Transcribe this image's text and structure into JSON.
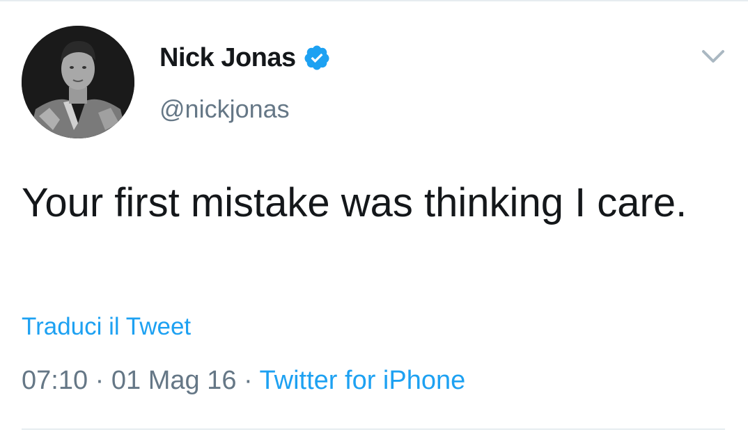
{
  "tweet": {
    "author": {
      "display_name": "Nick Jonas",
      "handle": "@nickjonas",
      "verified": true,
      "avatar_icon": "profile-photo",
      "verified_icon": "verified-badge-icon"
    },
    "text": "Your first mistake was thinking I care.",
    "translate_label": "Traduci il Tweet",
    "time": "07:10",
    "separator": "·",
    "date": "01 Mag 16",
    "source": "Twitter for iPhone",
    "menu_icon": "chevron-down-icon"
  },
  "colors": {
    "text_primary": "#14171a",
    "text_secondary": "#657786",
    "accent": "#1da1f2",
    "divider": "#e6ecf0",
    "background": "#ffffff"
  }
}
